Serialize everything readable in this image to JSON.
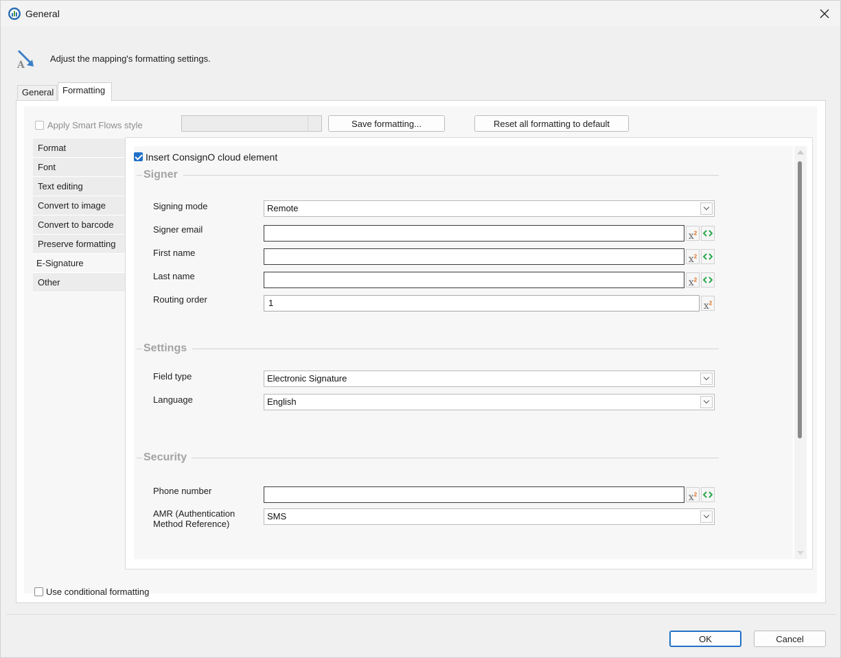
{
  "window": {
    "title": "General",
    "close_icon": "close-icon"
  },
  "header": {
    "description": "Adjust the mapping's formatting settings."
  },
  "tabs": [
    {
      "label": "General",
      "active": false
    },
    {
      "label": "Formatting",
      "active": true
    }
  ],
  "toolbar": {
    "apply_smart_flows_label": "Apply Smart Flows style",
    "apply_smart_flows_checked": false,
    "save_formatting_label": "Save formatting...",
    "reset_formatting_label": "Reset all formatting to default"
  },
  "side_nav": {
    "items": [
      {
        "label": "Format"
      },
      {
        "label": "Font"
      },
      {
        "label": "Text editing"
      },
      {
        "label": "Convert to image"
      },
      {
        "label": "Convert to barcode"
      },
      {
        "label": "Preserve formatting"
      },
      {
        "label": "E-Signature"
      },
      {
        "label": "Other"
      }
    ],
    "active_index": 6
  },
  "esignature": {
    "insert_label": "Insert ConsignO cloud element",
    "insert_checked": true,
    "signer": {
      "title": "Signer",
      "signing_mode_label": "Signing mode",
      "signing_mode_value": "Remote",
      "signer_email_label": "Signer email",
      "signer_email_value": "",
      "first_name_label": "First name",
      "first_name_value": "",
      "last_name_label": "Last name",
      "last_name_value": "",
      "routing_order_label": "Routing order",
      "routing_order_value": "1"
    },
    "settings": {
      "title": "Settings",
      "field_type_label": "Field type",
      "field_type_value": "Electronic Signature",
      "language_label": "Language",
      "language_value": "English"
    },
    "security": {
      "title": "Security",
      "phone_label": "Phone number",
      "phone_value": "",
      "amr_label_line1": "AMR (Authentication",
      "amr_label_line2": "Method Reference)",
      "amr_value": "SMS"
    }
  },
  "conditional": {
    "label": "Use conditional formatting",
    "checked": false
  },
  "footer": {
    "ok_label": "OK",
    "cancel_label": "Cancel"
  },
  "colors": {
    "accent": "#1f6fc6",
    "section_title": "#a3a3a3",
    "superscript_orange": "#e07020",
    "code_green": "#2aa84a"
  }
}
